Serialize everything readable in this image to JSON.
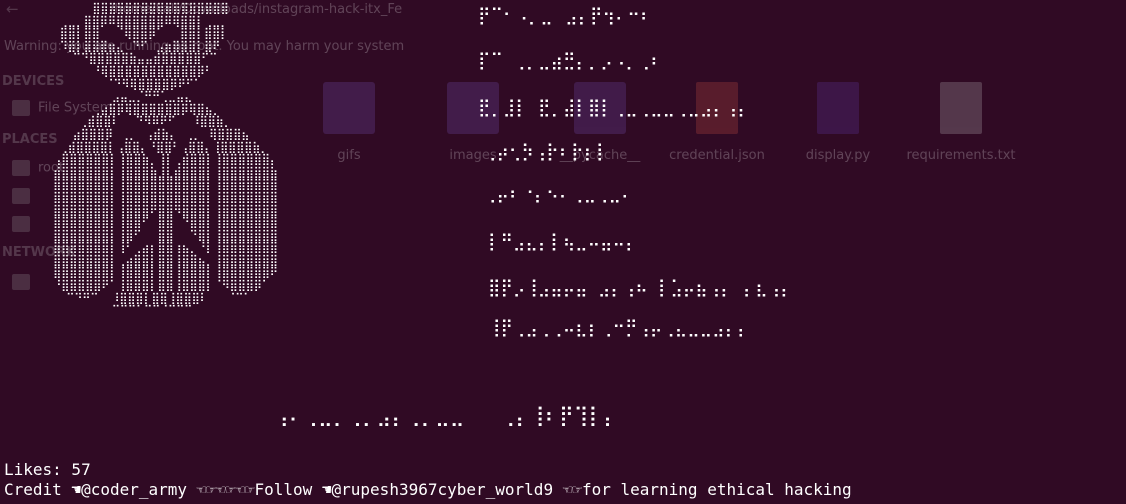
{
  "background_window": {
    "path": "/home/kali/Downloads/instagram-hack-itx_Fe",
    "warning": "Warning: you are running as root. You may harm your system",
    "sections": [
      "DEVICES",
      "PLACES",
      "NETWORK"
    ],
    "sidebar": {
      "file_system": "File System",
      "home": "root"
    },
    "files": [
      "gifs",
      "images",
      "__pycache__",
      "credential.json",
      "display.py",
      "requirements.txt"
    ]
  },
  "terminal": {
    "portrait_art": [
      "        ⣿⣿⣿⣿⣿⣿⣿⣿⣿⣿⣿⣿⣿⣿⣿⣿⣿",
      "   ⢀⣀⡀⣿⣿⡿⠿⣿⣿⣿⣿⣿⣿⠿⢿⣿⣿⡇⢀⣀⡀",
      "   ⣿⣿⡇⣿⣿⠀⠀⠈⢿⣿⣿⡿⠁⠀⠀⣿⣿⡇⣿⣿⡇",
      "   ⠹⣿⡇⣿⣿⣿⣶⣄⠀⠙⠋⠀⣠⣶⣿⣿⣿⡇⣿⠟",
      "     ⠉⠙⣿⣿⣿⣿⣿⣷⣤⣤⣾⣿⣿⣿⣿⣿⠋⠉",
      "        ⠘⢿⣿⣿⣿⣿⣿⣿⣿⣿⣿⣿⣿⡿⠃",
      "          ⠈⠙⠻⢿⣿⣿⣿⣿⡿⠟⠋⠁",
      "           ⣠⣤⣀⡈⠛⠛⢁⣀⣤⣄",
      "        ⢀⣴⣿⡿⢿⣿⣿⣿⣿⣿⣿⡿⢿⣿⣦⡀",
      "      ⢀⣾⣿⣿⠇⠀⠀⠙⠻⠿⠟⠋⠀⠀⠸⣿⣿⣷⡀",
      "     ⣴⣿⣿⣿⡿⠀⢀⡀⠀⢠⣾⣷⡄⠀⢀⡀⠀⢿⣿⣿⣿⣦",
      "   ⢀⣾⣿⣿⣿⣿⡇⢠⣿⣿⡄⠘⣿⣿⠃⢠⣿⣿⡄⢸⣿⣿⣿⣿⣷⡀",
      "  ⢠⣿⣿⣿⣿⣿⣿⡇⢸⣿⣿⣷⡀⢸⡇⢀⣾⣿⣿⡇⢸⣿⣿⣿⣿⣿⣿⡄",
      "  ⣾⣿⣿⣿⣿⣿⣿⡇⢸⣿⣿⣿⣷⣸⣇⣾⣿⣿⣿⡇⢸⣿⣿⣿⣿⣿⣿⣷",
      "  ⣿⣿⣿⣿⣿⣿⣿⡇⢸⣿⣿⣿⣿⣿⣿⣿⣿⣿⣿⡇⢸⣿⣿⣿⣿⣿⣿⣿",
      "  ⣿⣿⣿⣿⣿⣿⣿⡇⢸⣿⣿⣿⣿⣿⣿⣿⣿⣿⣿⡇⢸⣿⣿⣿⣿⣿⣿⣿",
      "  ⣿⣿⣿⣿⣿⣿⣿⡇⢸⣿⣿⣿⠟⣿⣿⠻⣿⣿⣿⡇⢸⣿⣿⣿⣿⣿⣿⣿",
      "  ⣿⣿⣿⣿⣿⣿⣿⡇⢸⣿⣿⠋⠀⣿⣿⠀⠙⣿⣿⡇⢸⣿⣿⣿⣿⣿⣿⣿",
      "  ⣿⣿⣿⣿⣿⣿⣿⡇⢸⣿⠋⠀⠀⣿⣿⠀⠀⠙⣿⡇⢸⣿⣿⣿⣿⣿⣿⣿",
      "  ⣿⣿⣿⣿⣿⣿⣿⡇⢸⠃⢀⣴⡆⣿⣿⢰⣦⡀⠘⡇⢸⣿⣿⣿⣿⣿⣿⣿",
      "  ⣿⣿⣿⣿⣿⣿⣿⡇⢀⣴⣿⣿⡇⣿⣿⢸⣿⣿⣦⡀⢸⣿⣿⣿⣿⣿⣿⣿",
      "  ⣿⣿⣿⣿⣿⣿⣿⡇⢸⣿⣿⣿⡇⣿⣿⢸⣿⣿⣿⡇⢸⣿⣿⣿⣿⣿⣿⠟",
      "  ⠘⣿⣿⣿⣿⣿⠟⠁⢸⣿⣿⣿⡇⣿⣿⢸⣿⣿⣿⡇⠈⠻⣿⣿⣿⡿⠁",
      "    ⠉⠙⠛⠉  ⠸⣿⣿⣿⡇⣿⣿⢸⣿⣿⣿⠇   ⠈⠉⠁",
      "           ⠉⠉⠉⠁⠉⠉⠈⠉⠉⠉"
    ],
    "menu_art": [
      "⡟⠉⠂⠠⡀⣀⠀⣠⡄⡟⢲⠄⠒⠆",
      "⡏⠉ ⢀⡀⣀⣴⣛⡄⡀⡠⠠⡀⢀⠆",
      "⣟⡀⣸⡇ ⣟⡀⣼⡇⣿⡇⢀⣀⢀⣀⣀⢀⣀⣠⡄⢠⡄",
      "⢀⡴⢂⡳⢠⡗⠆⡗⡆⡇",
      "⢀⡤⠆⠐⡄⠢⠄⢀⣀⢀⣀⠄",
      "⡇⠛⣠⣄⡄⡇⢦⣀⠤⣤⠤⡄",
      "⣿⡟⡠⢸⣠⣤⡤⣤ ⣠⡄⢠⠦ ⡇⣡⡤⣦⢠⡄ ⡄⣆⢠⡄",
      "⢸⡟⢀⣠⢀⢀⠤⣆⡆⢀⠒⡛⢠⡤⢀⣄⣀⣀⣠⡄⡄"
    ],
    "banner_art": "⢠⠄⢀⣀⡀⢀⡀⣠⡄⢀⡀⣀⣀   ⢀⡄⢸⠆⡟⢹⡇⡄",
    "likes_label": "Likes: 57",
    "credit_line": "Credit ☚︎@coder_army ☜︎☞︎☜︎☞︎☜︎☞︎Follow ☚︎@rupesh3967cyber_world9 ☜︎☞︎for learning ethical hacking"
  },
  "colors": {
    "terminal_bg": "#300a24",
    "terminal_fg": "#ffffff"
  }
}
